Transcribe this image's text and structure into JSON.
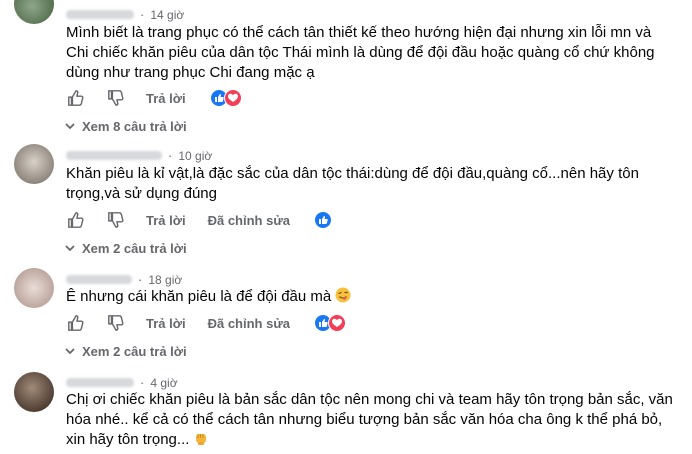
{
  "comments": [
    {
      "time": "14 giờ",
      "text": "Mình biết là trang phục có thể cách tân thiết kế theo hướng hiện đại nhưng xin lỗi mn và Chi chiếc khăn piêu của dân tộc Thái mình là dùng để đội đầu hoặc quàng cổ chứ không dùng như trang phục Chi đang mặc ạ",
      "reply_label": "Trả lời",
      "reactions": [
        "like-icon",
        "love-icon"
      ],
      "view_replies": "Xem 8 câu trả lời"
    },
    {
      "time": "10 giờ",
      "text": "Khăn piêu là kỉ vật,là đặc sắc của dân tộc thái:dùng để đội đầu,quàng cổ...nên hãy tôn trọng,và sử dụng đúng",
      "reply_label": "Trả lời",
      "edited_label": "Đã chỉnh sửa",
      "reactions": [
        "like-icon"
      ],
      "view_replies": "Xem 2 câu trả lời"
    },
    {
      "time": "18 giờ",
      "text": "Ê nhưng cái khăn piêu là để đội đầu mà",
      "reply_label": "Trả lời",
      "edited_label": "Đã chỉnh sửa",
      "reactions": [
        "like-icon",
        "love-icon"
      ],
      "view_replies": "Xem 2 câu trả lời"
    },
    {
      "time": "4 giờ",
      "text": "Chị ơi chiếc khăn piêu là bản sắc dân tộc nên mong chi và team hãy tôn trọng bản sắc, văn hóa nhé.. kể cả có thể cách tân nhưng biểu tượng bản sắc văn hóa cha ông k thể phá bỏ, xin hãy tôn trọng..."
    }
  ],
  "colors": {
    "secondary_text": "#65676b",
    "primary_text": "#050505",
    "like_blue": "#1877f2",
    "love_red": "#f33e58"
  }
}
